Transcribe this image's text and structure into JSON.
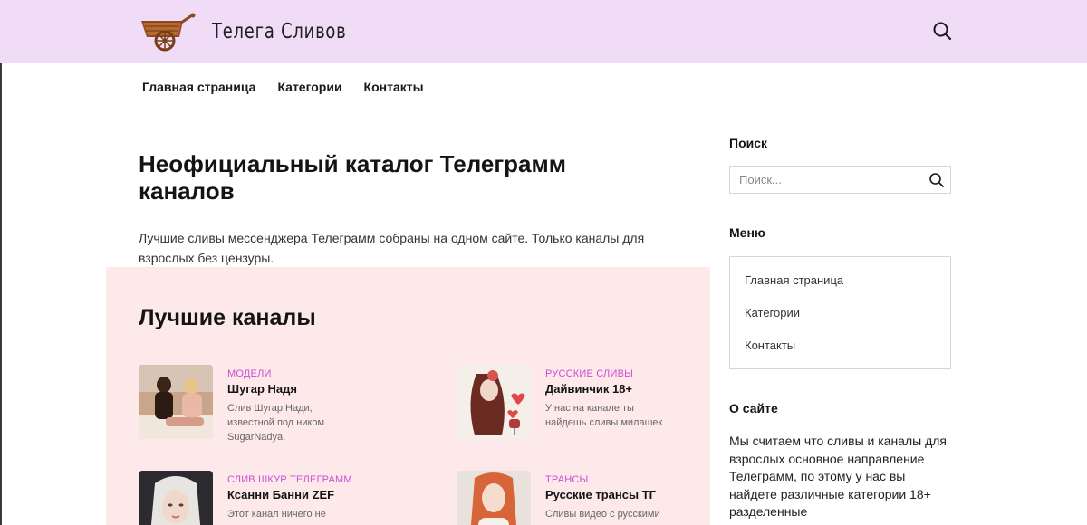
{
  "header": {
    "site_title": "Телега Сливов",
    "logo_icon": "cart-icon",
    "search_icon": "search-icon"
  },
  "nav": {
    "items": [
      {
        "label": "Главная страница"
      },
      {
        "label": "Категории"
      },
      {
        "label": "Контакты"
      }
    ]
  },
  "main": {
    "title": "Неофициальный каталог Телеграмм каналов",
    "intro": "Лучшие сливы мессенджера Телеграмм собраны на одном сайте. Только каналы для взрослых без цензуры.",
    "best_section": {
      "title": "Лучшие каналы",
      "cards": [
        {
          "category": "Модели",
          "name": "Шугар Надя",
          "description": "Слив Шугар Нади, известной под ником SugarNadya."
        },
        {
          "category": "Русские сливы",
          "name": "Дайвинчик 18+",
          "description": "У нас на канале ты найдешь сливы милашек"
        },
        {
          "category": "Слив шкур телеграмм",
          "name": "Ксанни Банни ZEF",
          "description": "Этот канал ничего не"
        },
        {
          "category": "Трансы",
          "name": "Русские трансы ТГ",
          "description": "Сливы видео с русскими"
        }
      ]
    }
  },
  "sidebar": {
    "search_heading": "Поиск",
    "search_placeholder": "Поиск...",
    "menu_heading": "Меню",
    "menu_items": [
      {
        "label": "Главная страница"
      },
      {
        "label": "Категории"
      },
      {
        "label": "Контакты"
      }
    ],
    "about_heading": "О сайте",
    "about_text": "Мы считаем что сливы и каналы для взрослых основное направление Телеграмм, по этому у нас вы найдете различные категории 18+ разделенные"
  },
  "colors": {
    "header_bg": "#f0dcf6",
    "panel_bg": "#fde9ea",
    "category_accent": "#c94fd6"
  }
}
